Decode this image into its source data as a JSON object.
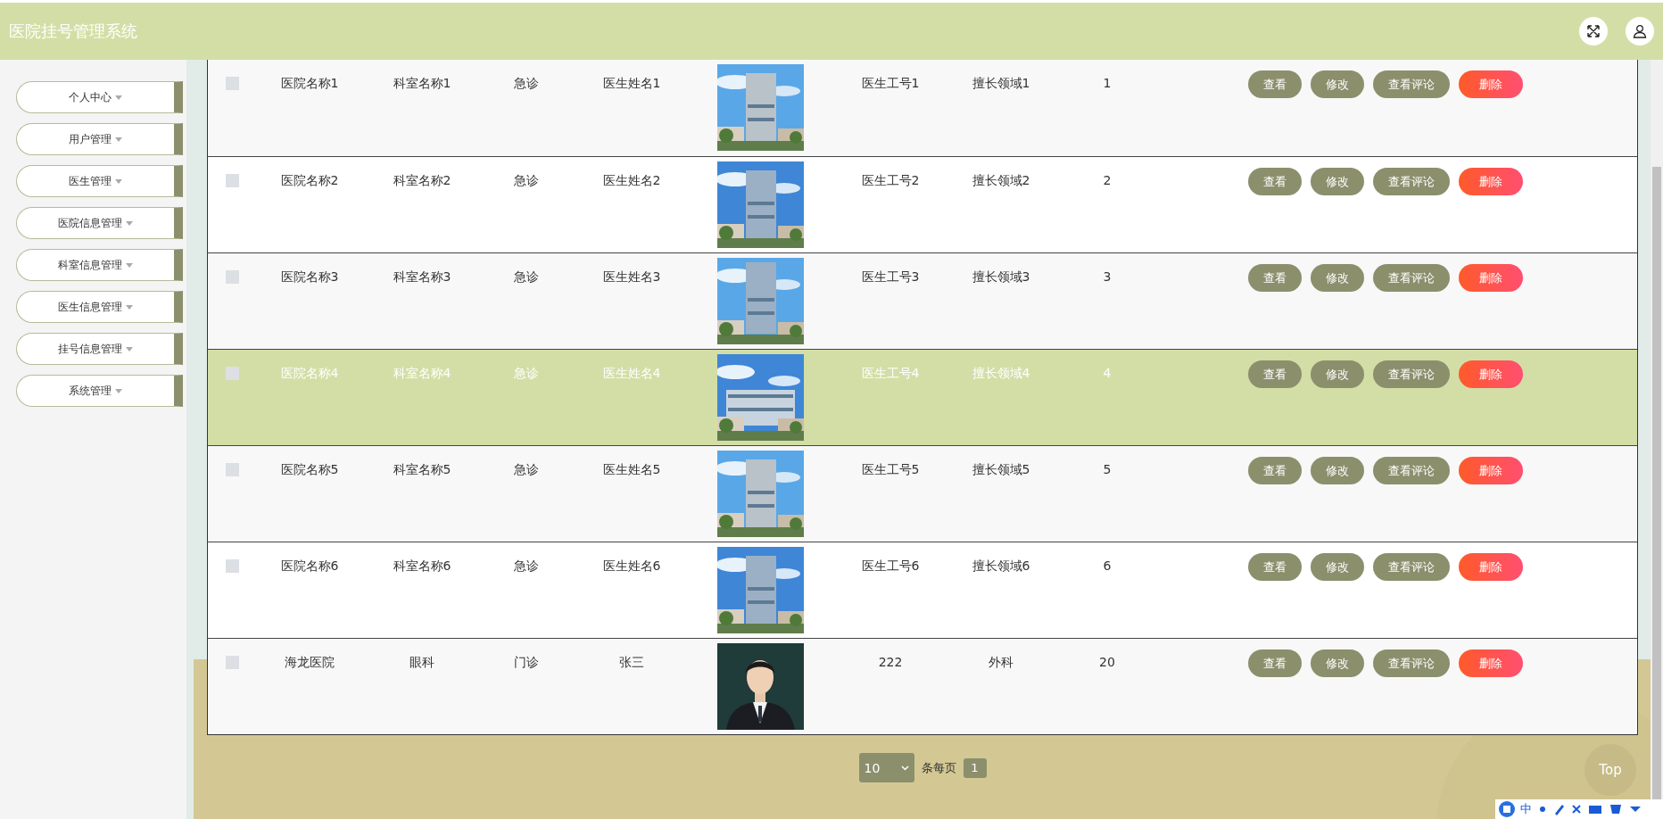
{
  "header": {
    "title": "医院挂号管理系统"
  },
  "sidebar": {
    "items": [
      {
        "label": "个人中心"
      },
      {
        "label": "用户管理"
      },
      {
        "label": "医生管理"
      },
      {
        "label": "医院信息管理"
      },
      {
        "label": "科室信息管理"
      },
      {
        "label": "医生信息管理"
      },
      {
        "label": "挂号信息管理"
      },
      {
        "label": "系统管理"
      }
    ]
  },
  "table": {
    "rows": [
      {
        "selected": false,
        "checked": false,
        "cells": [
          "医院名称1",
          "科室名称1",
          "急诊",
          "医生姓名1"
        ],
        "photo": {
          "kind": "picture"
        },
        "cells_after": [
          "医生工号1",
          "擅长领域1",
          "1"
        ],
        "actions": [
          {
            "label": "查看",
            "kind": "normal"
          },
          {
            "label": "修改",
            "kind": "normal"
          },
          {
            "label": "查看评论",
            "kind": "normal"
          },
          {
            "label": "删除",
            "kind": "danger"
          }
        ]
      },
      {
        "selected": false,
        "checked": false,
        "cells": [
          "医院名称2",
          "科室名称2",
          "急诊",
          "医生姓名2"
        ],
        "photo": {
          "kind": "picture"
        },
        "cells_after": [
          "医生工号2",
          "擅长领域2",
          "2"
        ],
        "actions": [
          {
            "label": "查看",
            "kind": "normal"
          },
          {
            "label": "修改",
            "kind": "normal"
          },
          {
            "label": "查看评论",
            "kind": "normal"
          },
          {
            "label": "删除",
            "kind": "danger"
          }
        ]
      },
      {
        "selected": false,
        "checked": false,
        "cells": [
          "医院名称3",
          "科室名称3",
          "急诊",
          "医生姓名3"
        ],
        "photo": {
          "kind": "picture"
        },
        "cells_after": [
          "医生工号3",
          "擅长领域3",
          "3"
        ],
        "actions": [
          {
            "label": "查看",
            "kind": "normal"
          },
          {
            "label": "修改",
            "kind": "normal"
          },
          {
            "label": "查看评论",
            "kind": "normal"
          },
          {
            "label": "删除",
            "kind": "danger"
          }
        ]
      },
      {
        "selected": true,
        "checked": false,
        "cells": [
          "医院名称4",
          "科室名称4",
          "急诊",
          "医生姓名4"
        ],
        "photo": {
          "kind": "picture"
        },
        "cells_after": [
          "医生工号4",
          "擅长领域4",
          "4"
        ],
        "actions": [
          {
            "label": "查看",
            "kind": "normal"
          },
          {
            "label": "修改",
            "kind": "normal"
          },
          {
            "label": "查看评论",
            "kind": "normal"
          },
          {
            "label": "删除",
            "kind": "danger"
          }
        ]
      },
      {
        "selected": false,
        "checked": false,
        "cells": [
          "医院名称5",
          "科室名称5",
          "急诊",
          "医生姓名5"
        ],
        "photo": {
          "kind": "picture"
        },
        "cells_after": [
          "医生工号5",
          "擅长领域5",
          "5"
        ],
        "actions": [
          {
            "label": "查看",
            "kind": "normal"
          },
          {
            "label": "修改",
            "kind": "normal"
          },
          {
            "label": "查看评论",
            "kind": "normal"
          },
          {
            "label": "删除",
            "kind": "danger"
          }
        ]
      },
      {
        "selected": false,
        "checked": false,
        "cells": [
          "医院名称6",
          "科室名称6",
          "急诊",
          "医生姓名6"
        ],
        "photo": {
          "kind": "picture"
        },
        "cells_after": [
          "医生工号6",
          "擅长领域6",
          "6"
        ],
        "actions": [
          {
            "label": "查看",
            "kind": "normal"
          },
          {
            "label": "修改",
            "kind": "normal"
          },
          {
            "label": "查看评论",
            "kind": "normal"
          },
          {
            "label": "删除",
            "kind": "danger"
          }
        ]
      },
      {
        "selected": false,
        "checked": false,
        "cells": [
          "海龙医院",
          "眼科",
          "门诊",
          "张三"
        ],
        "photo": {
          "kind": "picture"
        },
        "cells_after": [
          "222",
          "外科",
          "20"
        ],
        "actions": [
          {
            "label": "查看",
            "kind": "normal"
          },
          {
            "label": "修改",
            "kind": "normal"
          },
          {
            "label": "查看评论",
            "kind": "normal"
          },
          {
            "label": "删除",
            "kind": "danger"
          }
        ]
      }
    ]
  },
  "pagination": {
    "page_size": "10",
    "page_size_label": "条每页",
    "pages": [
      {
        "label": "1",
        "selected": true
      }
    ]
  },
  "top_button": {
    "label": "Top"
  },
  "ime_toolbar": {
    "label": "中"
  }
}
